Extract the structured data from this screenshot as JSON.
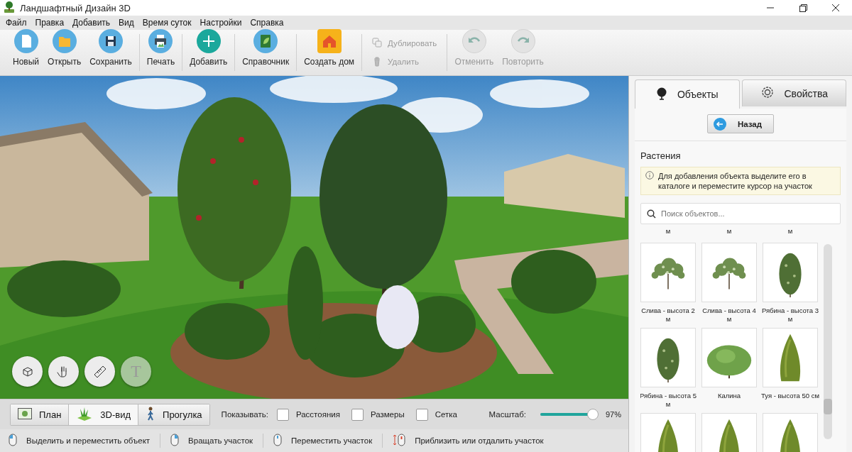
{
  "window": {
    "title": "Ландшафтный Дизайн 3D"
  },
  "menu": [
    "Файл",
    "Правка",
    "Добавить",
    "Вид",
    "Время суток",
    "Настройки",
    "Справка"
  ],
  "toolbar": [
    [
      {
        "label": "Новый",
        "kind": "large",
        "disabled": false
      },
      {
        "label": "Открыть",
        "kind": "large",
        "disabled": false
      },
      {
        "label": "Сохранить",
        "kind": "large",
        "disabled": false
      }
    ],
    [
      {
        "label": "Печать",
        "kind": "large",
        "disabled": false
      }
    ],
    [
      {
        "label": "Добавить",
        "kind": "large",
        "disabled": false
      }
    ],
    [
      {
        "label": "Справочник",
        "kind": "large",
        "disabled": false
      }
    ],
    [
      {
        "label": "Создать дом",
        "kind": "large",
        "disabled": false
      }
    ],
    [
      {
        "label": "Дублировать",
        "kind": "small",
        "disabled": true
      },
      {
        "label": "Удалить",
        "kind": "small",
        "disabled": true
      }
    ],
    [
      {
        "label": "Отменить",
        "kind": "large",
        "disabled": true
      },
      {
        "label": "Повторить",
        "kind": "large",
        "disabled": true
      }
    ]
  ],
  "viewport_tools": [
    {
      "disabled": false
    },
    {
      "disabled": false
    },
    {
      "disabled": false
    },
    {
      "label": "T",
      "disabled": true
    }
  ],
  "panel": {
    "tabs": [
      {
        "label": "Объекты",
        "selected": true
      },
      {
        "label": "Свойства",
        "selected": false
      }
    ],
    "back_button": "Назад",
    "section_title": "Растения",
    "hint": "Для добавления объекта выделите его в каталоге и переместите курсор на участок",
    "search": {
      "placeholder": "Поиск объектов..."
    },
    "catalog": [
      {
        "label": "м",
        "kind": "cut"
      },
      {
        "label": "м",
        "kind": "cut"
      },
      {
        "label": "м",
        "kind": "cut"
      },
      {
        "label": "Слива - высота 2 м",
        "kind": "leafy"
      },
      {
        "label": "Слива - высота 4 м",
        "kind": "leafy"
      },
      {
        "label": "Рябина - высота 3 м",
        "kind": "tall"
      },
      {
        "label": "Рябина - высота 5 м",
        "kind": "tall"
      },
      {
        "label": "Калина",
        "kind": "bush"
      },
      {
        "label": "Туя - высота 50 см",
        "kind": "conifer"
      },
      {
        "kind": "conifer"
      },
      {
        "kind": "conifer"
      },
      {
        "kind": "conifer"
      }
    ]
  },
  "view_modes": [
    {
      "label": "План",
      "selected": false
    },
    {
      "label": "3D-вид",
      "selected": true
    },
    {
      "label": "Прогулка",
      "selected": false
    }
  ],
  "show": {
    "label": "Показывать:",
    "options": [
      {
        "label": "Расстояния",
        "checked": false
      },
      {
        "label": "Размеры",
        "checked": false
      },
      {
        "label": "Сетка",
        "checked": false
      }
    ]
  },
  "zoom": {
    "label": "Масштаб:",
    "level": 0.95,
    "reading": "97%"
  },
  "status_hints": [
    "Выделить и переместить объект",
    "Вращать участок",
    "Переместить участок",
    "Приблизить или отдалить участок"
  ]
}
